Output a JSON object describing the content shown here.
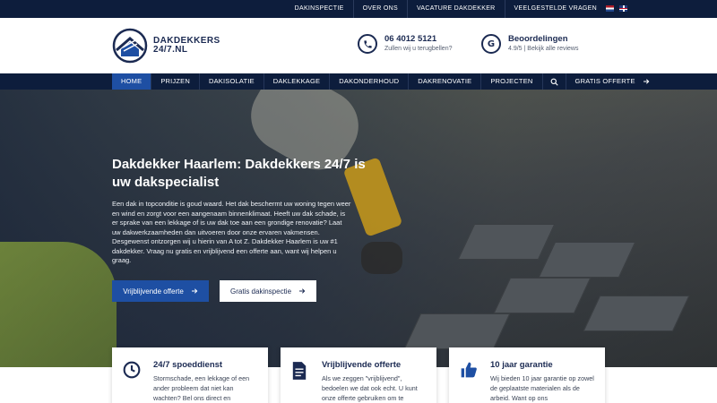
{
  "topbar": {
    "links": [
      "DAKINSPECTIE",
      "OVER ONS",
      "VACATURE DAKDEKKER",
      "VEELGESTELDE VRAGEN"
    ],
    "languages": [
      "nl-flag-icon",
      "en-flag-icon"
    ]
  },
  "logo": {
    "line1": "DAKDEKKERS",
    "line2": "24/7.NL",
    "icon": "house-roof-logo-icon"
  },
  "contact": {
    "phone": {
      "number": "06 4012 5121",
      "sub": "Zullen wij u terugbellen?",
      "icon": "phone-icon"
    },
    "reviews": {
      "title": "Beoordelingen",
      "sub": "4.9/5 | Bekijk alle reviews",
      "icon": "google-icon"
    }
  },
  "nav": {
    "items": [
      "HOME",
      "PRIJZEN",
      "DAKISOLATIE",
      "DAKLEKKAGE",
      "DAKONDERHOUD",
      "DAKRENOVATIE",
      "PROJECTEN"
    ],
    "active": "HOME",
    "search_icon": "search-icon",
    "cta": "GRATIS OFFERTE"
  },
  "hero": {
    "title_bold": "Dakdekker Haarlem:",
    "title_rest": " Dakdekkers 24/7 is uw dakspecialist",
    "text": "Een dak in topconditie is goud waard. Het dak beschermt uw woning tegen weer en wind en zorgt voor een aangenaam binnenklimaat. Heeft uw dak schade, is er sprake van een lekkage of is uw dak toe aan een grondige renovatie? Laat uw dakwerkzaamheden dan uitvoeren door onze ervaren vakmensen. Desgewenst ontzorgen wij u hierin van A tot Z. Dakdekker Haarlem is uw #1 dakdekker. Vraag nu gratis en vrijblijvend een offerte aan, want wij helpen u graag.",
    "btn_primary": "Vrijblijvende offerte",
    "btn_secondary": "Gratis dakinspectie"
  },
  "cards": [
    {
      "icon": "clock-icon",
      "title": "24/7 spoeddienst",
      "text": "Stormschade, een lekkage of een ander probleem dat niet kan wachten? Bel ons direct en"
    },
    {
      "icon": "document-icon",
      "title": "Vrijblijvende offerte",
      "text": "Als we zeggen \"vrijblijvend\", bedoelen we dat ook echt. U kunt onze offerte gebruiken om te"
    },
    {
      "icon": "thumbs-up-icon",
      "title": "10 jaar garantie",
      "text": "Wij bieden 10 jaar garantie op zowel de geplaatste materialen als de arbeid. Want op ons"
    }
  ],
  "colors": {
    "navy": "#0d1d3c",
    "accent_blue": "#1e4fa3",
    "text_dark": "#1b2a52"
  }
}
